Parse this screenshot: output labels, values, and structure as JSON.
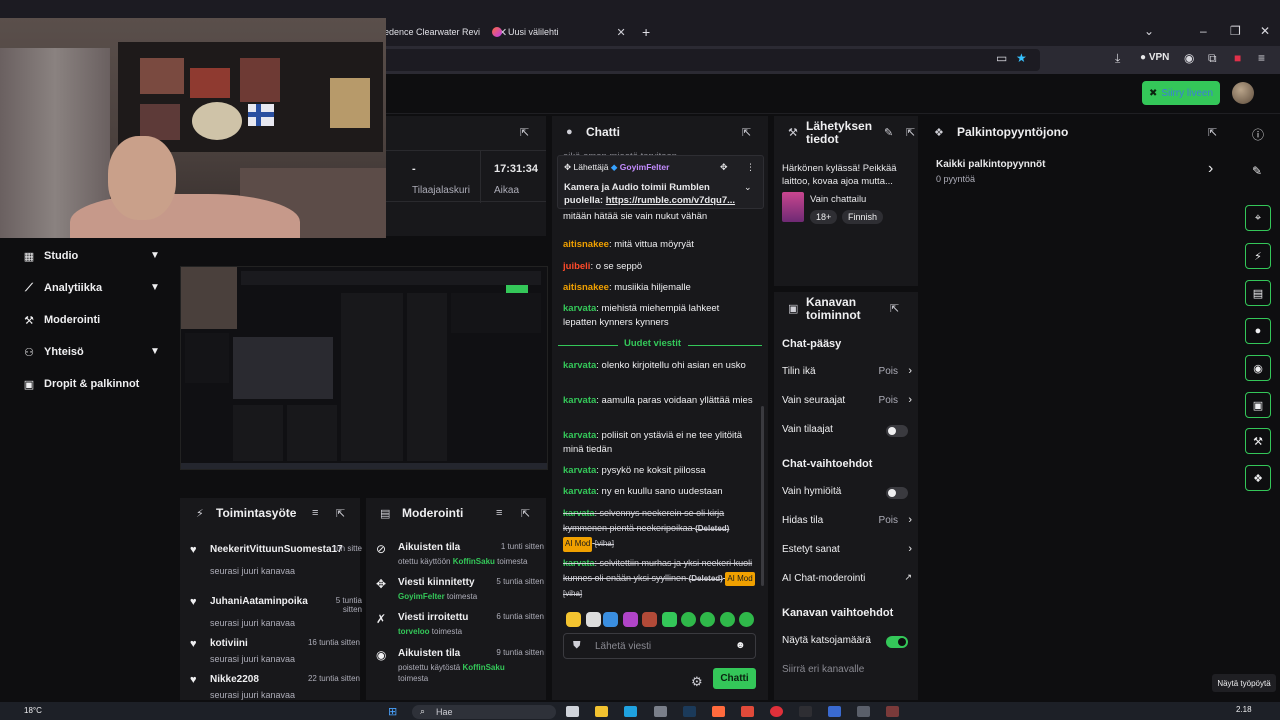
{
  "browser": {
    "tabs": [
      {
        "label": "edence Clearwater Revi"
      },
      {
        "label": "Uusi välilehti"
      }
    ],
    "new_tab": "+",
    "vpn_label": "VPN"
  },
  "header": {
    "go_live": "Siirry liveen"
  },
  "left_nav": {
    "items": [
      {
        "label": "Studio",
        "icon": "film-icon"
      },
      {
        "label": "Analytiikka",
        "icon": "chart-icon"
      },
      {
        "label": "Moderointi",
        "icon": "wrench-icon"
      },
      {
        "label": "Yhteisö",
        "icon": "people-icon"
      },
      {
        "label": "Dropit & palkinnot",
        "icon": "gift-icon"
      }
    ]
  },
  "stats": {
    "followers_value": "-",
    "followers_label": "Tilaajalaskuri",
    "time_value": "17:31:34",
    "time_label": "Aikaa"
  },
  "activity": {
    "title": "Toimintasyöte",
    "items": [
      {
        "who": "NeekeritVittuunSuomesta17",
        "what": "seurasi juuri kanavaa",
        "when": "tun sitte"
      },
      {
        "who": "JuhaniAataminpoika",
        "what": "seurasi juuri kanavaa",
        "when": "5 tuntia sitten"
      },
      {
        "who": "kotiviini",
        "what": "seurasi juuri kanavaa",
        "when": "16 tuntia sitten"
      },
      {
        "who": "Nikke2208",
        "what": "seurasi juuri kanavaa",
        "when": "22 tuntia sitten"
      }
    ]
  },
  "moderation": {
    "title": "Moderointi",
    "items": [
      {
        "title": "Aikuisten tila",
        "desc_pre": "otettu käyttöön ",
        "user": "KoffinSaku",
        "desc_post": " toimesta",
        "when": "1 tunti sitten",
        "icon": "eye-off-icon"
      },
      {
        "title": "Viesti kiinnitetty",
        "desc_pre": "",
        "user": "GoyimFelter",
        "desc_post": " toimesta",
        "when": "5 tuntia sitten",
        "icon": "pin-icon"
      },
      {
        "title": "Viesti irroitettu",
        "desc_pre": "",
        "user": "torveloo",
        "desc_post": " toimesta",
        "when": "6 tuntia sitten",
        "icon": "unpin-icon"
      },
      {
        "title": "Aikuisten tila",
        "desc_pre": "poistettu käytöstä ",
        "user": "KoffinSaku",
        "desc_post": " toimesta",
        "when": "9 tuntia sitten",
        "icon": "eye-icon"
      }
    ]
  },
  "chat": {
    "title": "Chatti",
    "top_partial": "eikä omon mieotä tarvitaan",
    "pinned": {
      "label": "Lähettäjä",
      "user": "GoyimFelter",
      "text": "Kamera ja Audio toimii Rumblen puolella: ",
      "link": "https://rumble.com/v7dqu7..."
    },
    "pinned_behind": "mitään hätää sie vain nukut vähän",
    "messages": [
      {
        "user": "aitisnakee",
        "color": "#f0a000",
        "text": ": mitä vittua möyryät"
      },
      {
        "user": "juibeli",
        "color": "#ff4a2a",
        "text": ": o se seppö"
      },
      {
        "user": "aitisnakee",
        "color": "#f0a000",
        "text": ": musiikia hiljemalle"
      },
      {
        "user": "karvata",
        "color": "#34c759",
        "text": ": miehistä miehempiä lahkeet lepatten kynners kynners"
      }
    ],
    "new_messages": "Uudet viestit",
    "new": [
      {
        "user": "karvata",
        "text": ": olenko kirjoitellu ohi asian en usko"
      },
      {
        "user": "karvata",
        "text": ": aamulla paras voidaan yllättää mies"
      },
      {
        "user": "karvata",
        "text": ": poliisit on ystäviä ei ne tee ylitöitä minä tiedän"
      },
      {
        "user": "karvata",
        "text": ": pysykö ne koksit piilossa"
      },
      {
        "user": "karvata",
        "text": ": ny en kuullu sano uudestaan"
      }
    ],
    "deleted": [
      {
        "user": "karvata",
        "text": ": selvennys neekerein se oli kirja kymmenen pientä neekeripoikaa",
        "deleted": "(Deleted)",
        "ai": "AI Mod",
        "reason": "[viha]"
      },
      {
        "user": "karvata",
        "text": ": selvitettiin murhas ja yksi neekeri kuoli kunnes oli enään yksi syyllinen",
        "deleted": "(Deleted)",
        "ai": "AI Mod",
        "reason": "[viha]"
      }
    ],
    "placeholder": "Lähetä viesti",
    "send": "Chatti"
  },
  "stream_info": {
    "title": "Lähetyksen tiedot",
    "stream_title": "Härkönen kylässä! Peikkää laittoo, kovaa ajoa mutta...",
    "category": "Vain chattailu",
    "tags": [
      "18+",
      "Finnish"
    ]
  },
  "channel_actions": {
    "title": "Kanavan toiminnot",
    "chat_access": "Chat-pääsy",
    "account_age": {
      "label": "Tilin ikä",
      "value": "Pois"
    },
    "followers_only": {
      "label": "Vain seuraajat",
      "value": "Pois"
    },
    "subscribers_only": {
      "label": "Vain tilaajat"
    },
    "chat_options": "Chat-vaihtoehdot",
    "emotes_only": {
      "label": "Vain hymiöitä"
    },
    "slow_mode": {
      "label": "Hidas tila",
      "value": "Pois"
    },
    "blocked_words": {
      "label": "Estetyt sanat"
    },
    "ai_mod": {
      "label": "AI Chat-moderointi"
    },
    "channel_options": "Kanavan vaihtoehdot",
    "show_viewers": {
      "label": "Näytä katsojamäärä"
    },
    "raid": {
      "label": "Siirrä eri kanavalle"
    }
  },
  "rewards": {
    "title": "Palkintopyyntöjono",
    "all": "Kaikki palkintopyynnöt",
    "count": "0 pyyntöä"
  },
  "tooltip": "Näytä työpöytä",
  "taskbar": {
    "weather": "18°C",
    "search": "Hae",
    "time": "2.18"
  },
  "colors": {
    "accent": "#34c759",
    "background": "#0e0e10",
    "panel": "#18181b"
  }
}
